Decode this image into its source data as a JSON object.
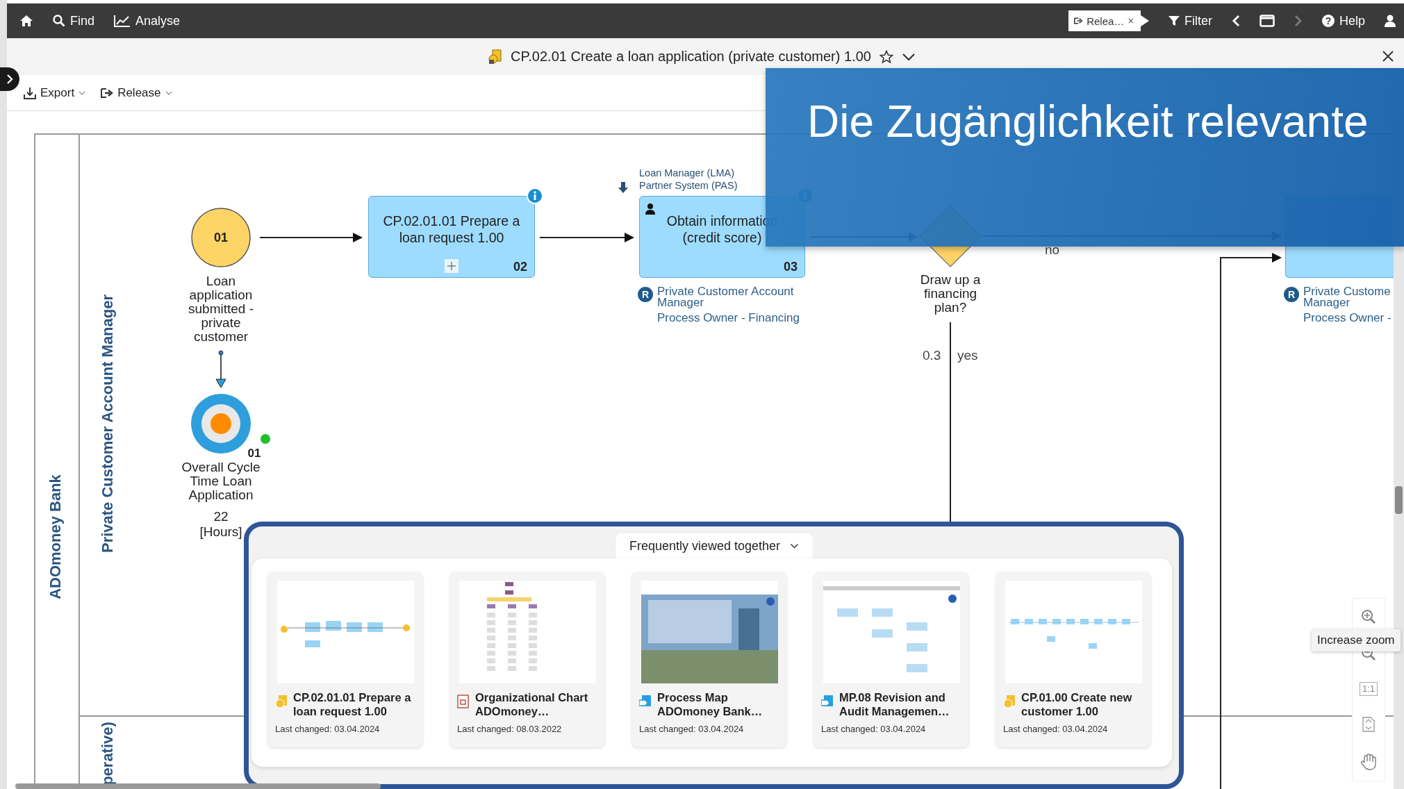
{
  "top_bar": {
    "nav": [
      {
        "kind": "home"
      },
      {
        "kind": "find",
        "label": "Find"
      },
      {
        "kind": "analyse",
        "label": "Analyse"
      }
    ],
    "release_chip": {
      "label": "Relea…"
    },
    "tools": [
      {
        "kind": "filter",
        "label": "Filter",
        "disabled": false
      },
      {
        "kind": "back",
        "disabled": false
      },
      {
        "kind": "window",
        "disabled": false
      },
      {
        "kind": "forward",
        "disabled": true
      },
      {
        "kind": "help",
        "glyph": "?",
        "label": "Help",
        "disabled": false
      },
      {
        "kind": "user",
        "disabled": false
      }
    ]
  },
  "title_bar": {
    "title": "CP.02.01 Create a loan application (private customer) 1.00",
    "favorite": false
  },
  "toolbar": {
    "actions": [
      {
        "kind": "export",
        "label": "Export"
      },
      {
        "kind": "release",
        "label": "Release"
      }
    ]
  },
  "diagram": {
    "pool_label": "ADOmoney Bank",
    "lanes": [
      {
        "label": "Private Customer Account Manager"
      },
      {
        "label": "perative)"
      }
    ],
    "start_event": {
      "number": "01",
      "label": "Loan application submitted - private customer"
    },
    "tasks": [
      {
        "number": "02",
        "title": "CP.02.01.01 Prepare a loan request 1.00",
        "subprocess": true,
        "info": true
      },
      {
        "number": "03",
        "title": "Obtain information (credit score)",
        "performer": true,
        "info": true,
        "systems": [
          "Loan Manager (LMA)",
          "Partner System (PAS)"
        ],
        "role_marker": "R",
        "roles": [
          "Private Customer Account Manager",
          "Process Owner - Financing"
        ]
      },
      {
        "role_marker": "R",
        "roles": [
          "Private Custome\nManager",
          "Process Owner -"
        ]
      }
    ],
    "gateway": {
      "label": "Draw up a financing plan?",
      "branches": [
        {
          "label": "no"
        },
        {
          "label": "yes",
          "probability": "0.3"
        }
      ]
    },
    "kpi": {
      "number": "01",
      "label": "Overall Cycle Time Loan Application",
      "value": "22",
      "unit": "[Hours]"
    }
  },
  "related_panel": {
    "heading": "Frequently viewed together",
    "cards": [
      {
        "kind": "process",
        "title": "CP.02.01.01 Prepare a loan request 1.00",
        "changed": "Last changed: 03.04.2024"
      },
      {
        "kind": "org-chart",
        "title": "Organizational Chart ADOmoney…",
        "changed": "Last changed: 08.03.2022"
      },
      {
        "kind": "process-map",
        "title": "Process Map ADOmoney Bank…",
        "changed": "Last changed: 03.04.2024"
      },
      {
        "kind": "process-map",
        "title": "MP.08 Revision and Audit Managemen…",
        "changed": "Last changed: 03.04.2024"
      },
      {
        "kind": "process",
        "title": "CP.01.00 Create new customer 1.00",
        "changed": "Last changed: 03.04.2024"
      }
    ]
  },
  "zoom_tools": {
    "actual_size": "1:1",
    "tooltip": "Increase zoom"
  },
  "caption_banner": {
    "text": "Die Zugänglichkeit relevante"
  }
}
